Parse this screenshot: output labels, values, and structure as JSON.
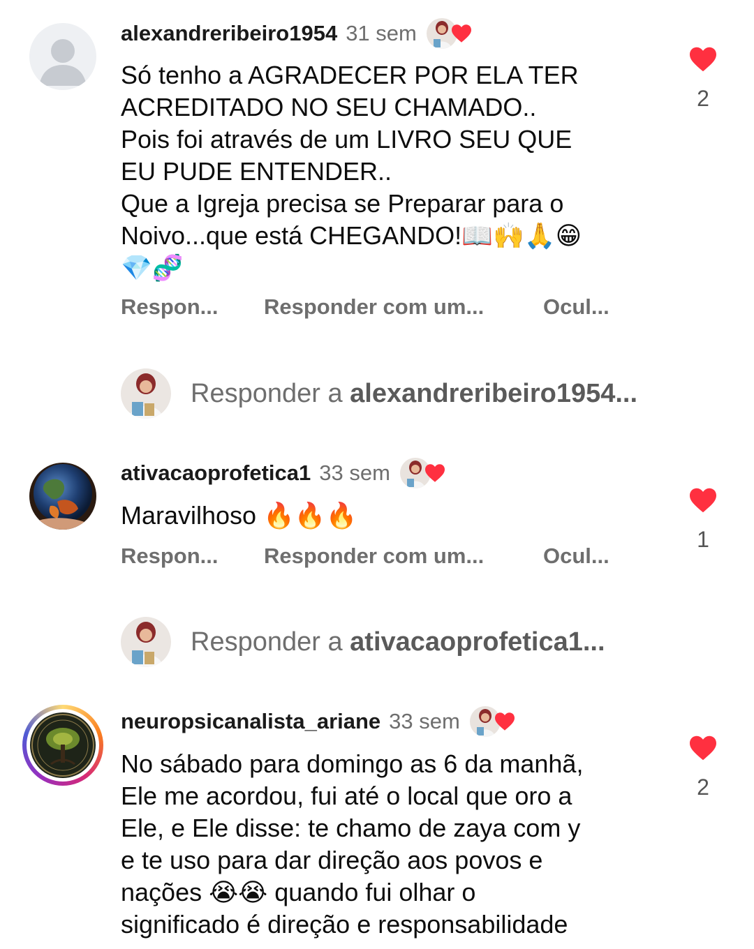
{
  "comments": [
    {
      "username": "alexandreribeiro1954",
      "time": "31 sem",
      "text": "Só tenho a AGRADECER POR ELA TER\nACREDITADO NO SEU CHAMADO..\nPois foi através de um LIVRO SEU QUE\nEU PUDE ENTENDER..\nQue a Igreja precisa se Preparar para o\nNoivo...que está CHEGANDO!📖🙌🙏😁\n💎🧬",
      "likes": "2",
      "actions": [
        "Respon...",
        "Responder com um...",
        "Ocul..."
      ],
      "reply_prefix": "Responder a ",
      "reply_user": "alexandreribeiro1954..."
    },
    {
      "username": "ativacaoprofetica1",
      "time": "33 sem",
      "text": "Maravilhoso 🔥🔥🔥",
      "likes": "1",
      "actions": [
        "Respon...",
        "Responder com um...",
        "Ocul..."
      ],
      "reply_prefix": "Responder a ",
      "reply_user": "ativacaoprofetica1..."
    },
    {
      "username": "neuropsicanalista_ariane",
      "time": "33 sem",
      "text": "No sábado para domingo as 6 da manhã,\nEle me acordou, fui até o local que oro a\nEle, e Ele disse: te chamo de zaya com y\ne te uso para dar direção aos povos e\nnações 😭😭 quando fui olhar o\nsignificado é direção e responsabilidade",
      "likes": "2"
    }
  ],
  "colors": {
    "heart": "#ff3040",
    "muted": "#6e6e6e",
    "username": "#1a1a1a"
  },
  "icons": [
    "person-silhouette-icon",
    "heart-icon"
  ]
}
